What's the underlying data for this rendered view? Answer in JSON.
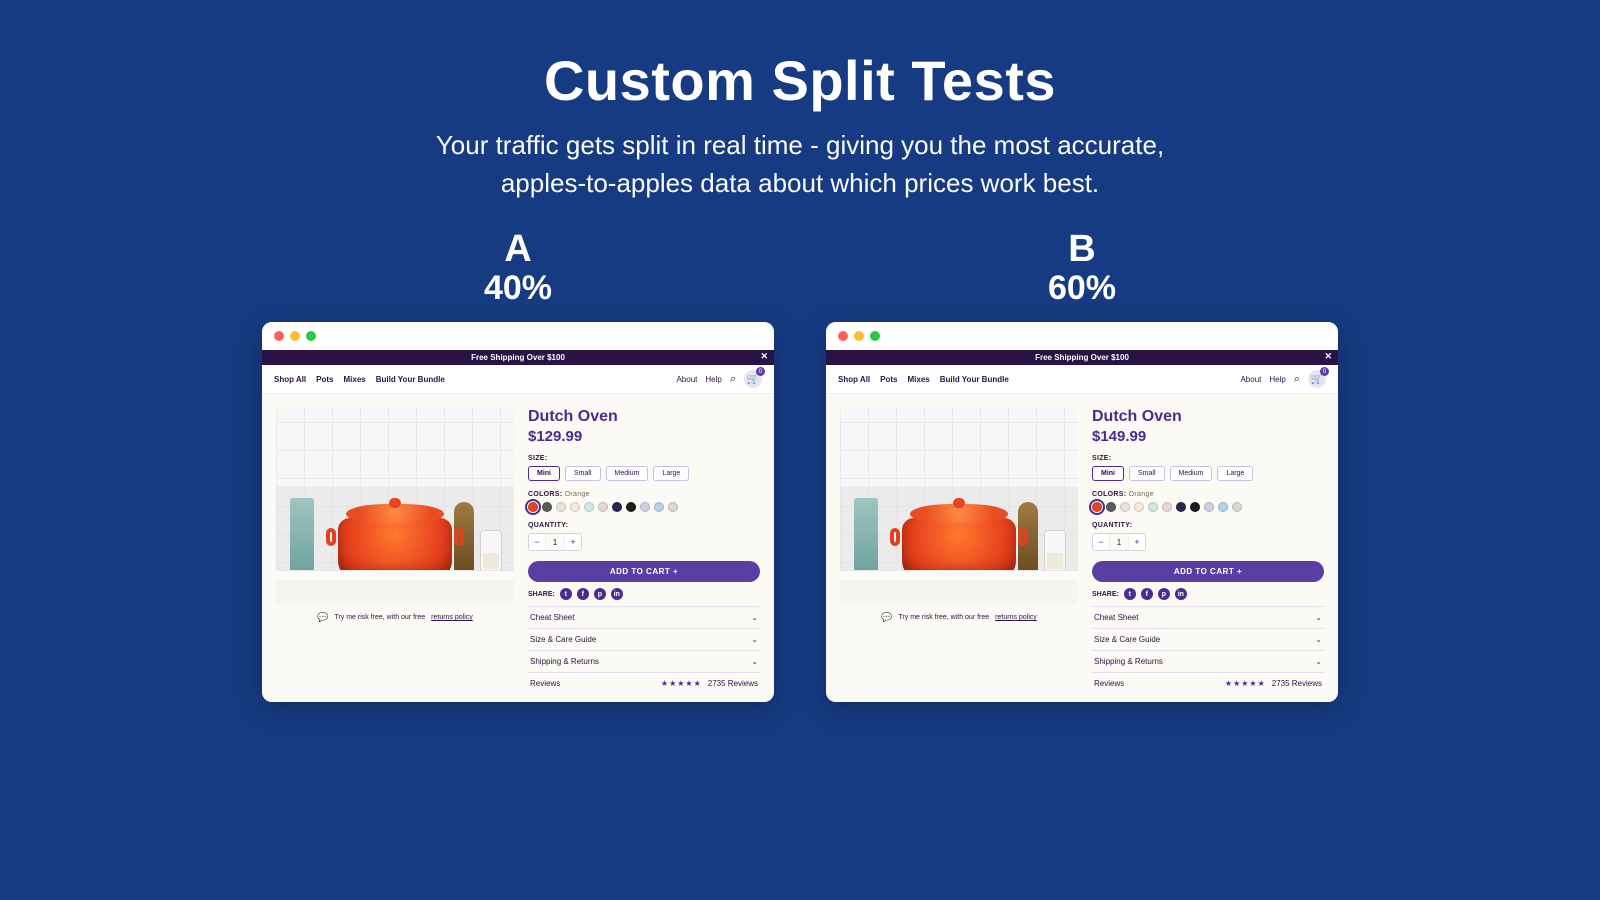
{
  "header": {
    "title": "Custom Split Tests",
    "subtitle": "Your traffic gets split in real time - giving you the most accurate,\napples-to-apples data about which prices work best."
  },
  "variants": [
    {
      "label": "A",
      "percent": "40%",
      "price": "$129.99"
    },
    {
      "label": "B",
      "percent": "60%",
      "price": "$149.99"
    }
  ],
  "promo_bar": {
    "text": "Free Shipping Over $100",
    "close": "✕"
  },
  "nav": {
    "items": [
      "Shop All",
      "Pots",
      "Mixes",
      "Build Your Bundle"
    ],
    "right": [
      "About",
      "Help"
    ],
    "cart_count": "0"
  },
  "product": {
    "name": "Dutch Oven",
    "size_label": "SIZE:",
    "sizes": [
      "Mini",
      "Small",
      "Medium",
      "Large"
    ],
    "selected_size": "Mini",
    "colors_label": "COLORS:",
    "color_name": "Orange",
    "swatches": [
      "#e8431e",
      "#5b5b5b",
      "#e7e4dc",
      "#f6e9d7",
      "#cfe8dc",
      "#e8d4df",
      "#2b2455",
      "#1d1d1d",
      "#d1cfe5",
      "#b2d2e8",
      "#d9d8cf"
    ],
    "qty_label": "QUANTITY:",
    "qty_value": "1",
    "add_label": "ADD TO CART  +",
    "share_label": "SHARE:",
    "share_icons": [
      "t",
      "f",
      "p",
      "in"
    ],
    "risk_text_a": "Try me risk free, with our free",
    "risk_link": "returns policy",
    "accordion": [
      "Cheat Sheet",
      "Size & Care Guide",
      "Shipping & Returns"
    ],
    "reviews_label": "Reviews",
    "reviews_count": "2735 Reviews"
  }
}
